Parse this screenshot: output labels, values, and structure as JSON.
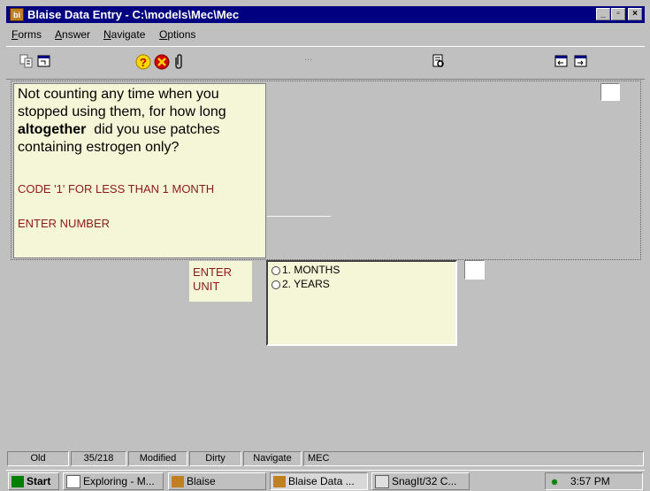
{
  "window": {
    "title": "Blaise Data Entry - C:\\models\\Mec\\Mec",
    "app_icon": "bi",
    "min_icon": "_",
    "max_icon": "▫",
    "close_icon": "×"
  },
  "menu": [
    {
      "label": "Forms",
      "u": "F",
      "rest": "orms"
    },
    {
      "label": "Answer",
      "u": "A",
      "rest": "nswer"
    },
    {
      "label": "Navigate",
      "u": "N",
      "rest": "avigate"
    },
    {
      "label": "Options",
      "u": "O",
      "rest": "ptions"
    }
  ],
  "toolbar": {
    "dots": "...",
    "help_icon": "?",
    "stop_icon": "✕",
    "clip_icon": "❙"
  },
  "question": {
    "line1": "Not counting any time when you stopped using them, for how long",
    "bold": "altogether",
    "line2": "did you use patches containing estrogen only?",
    "instruction1": "CODE '1' FOR LESS THAN 1 MONTH",
    "instruction2": "ENTER NUMBER"
  },
  "unit": {
    "label_line1": "ENTER",
    "label_line2": "UNIT",
    "options": [
      "1. MONTHS",
      "2. YEARS"
    ]
  },
  "status": [
    "Old",
    "35/218",
    "Modified",
    "Dirty",
    "Navigate",
    "MEC"
  ],
  "taskbar": {
    "start": "Start",
    "buttons": [
      "Exploring - M...",
      "Blaise",
      "Blaise Data ...",
      "SnagIt/32 C..."
    ],
    "time": "3:57 PM"
  },
  "colors": {
    "titlebar": "#000080",
    "question_bg": "#f5f5d7",
    "instruction_text": "#8b1a1a"
  }
}
